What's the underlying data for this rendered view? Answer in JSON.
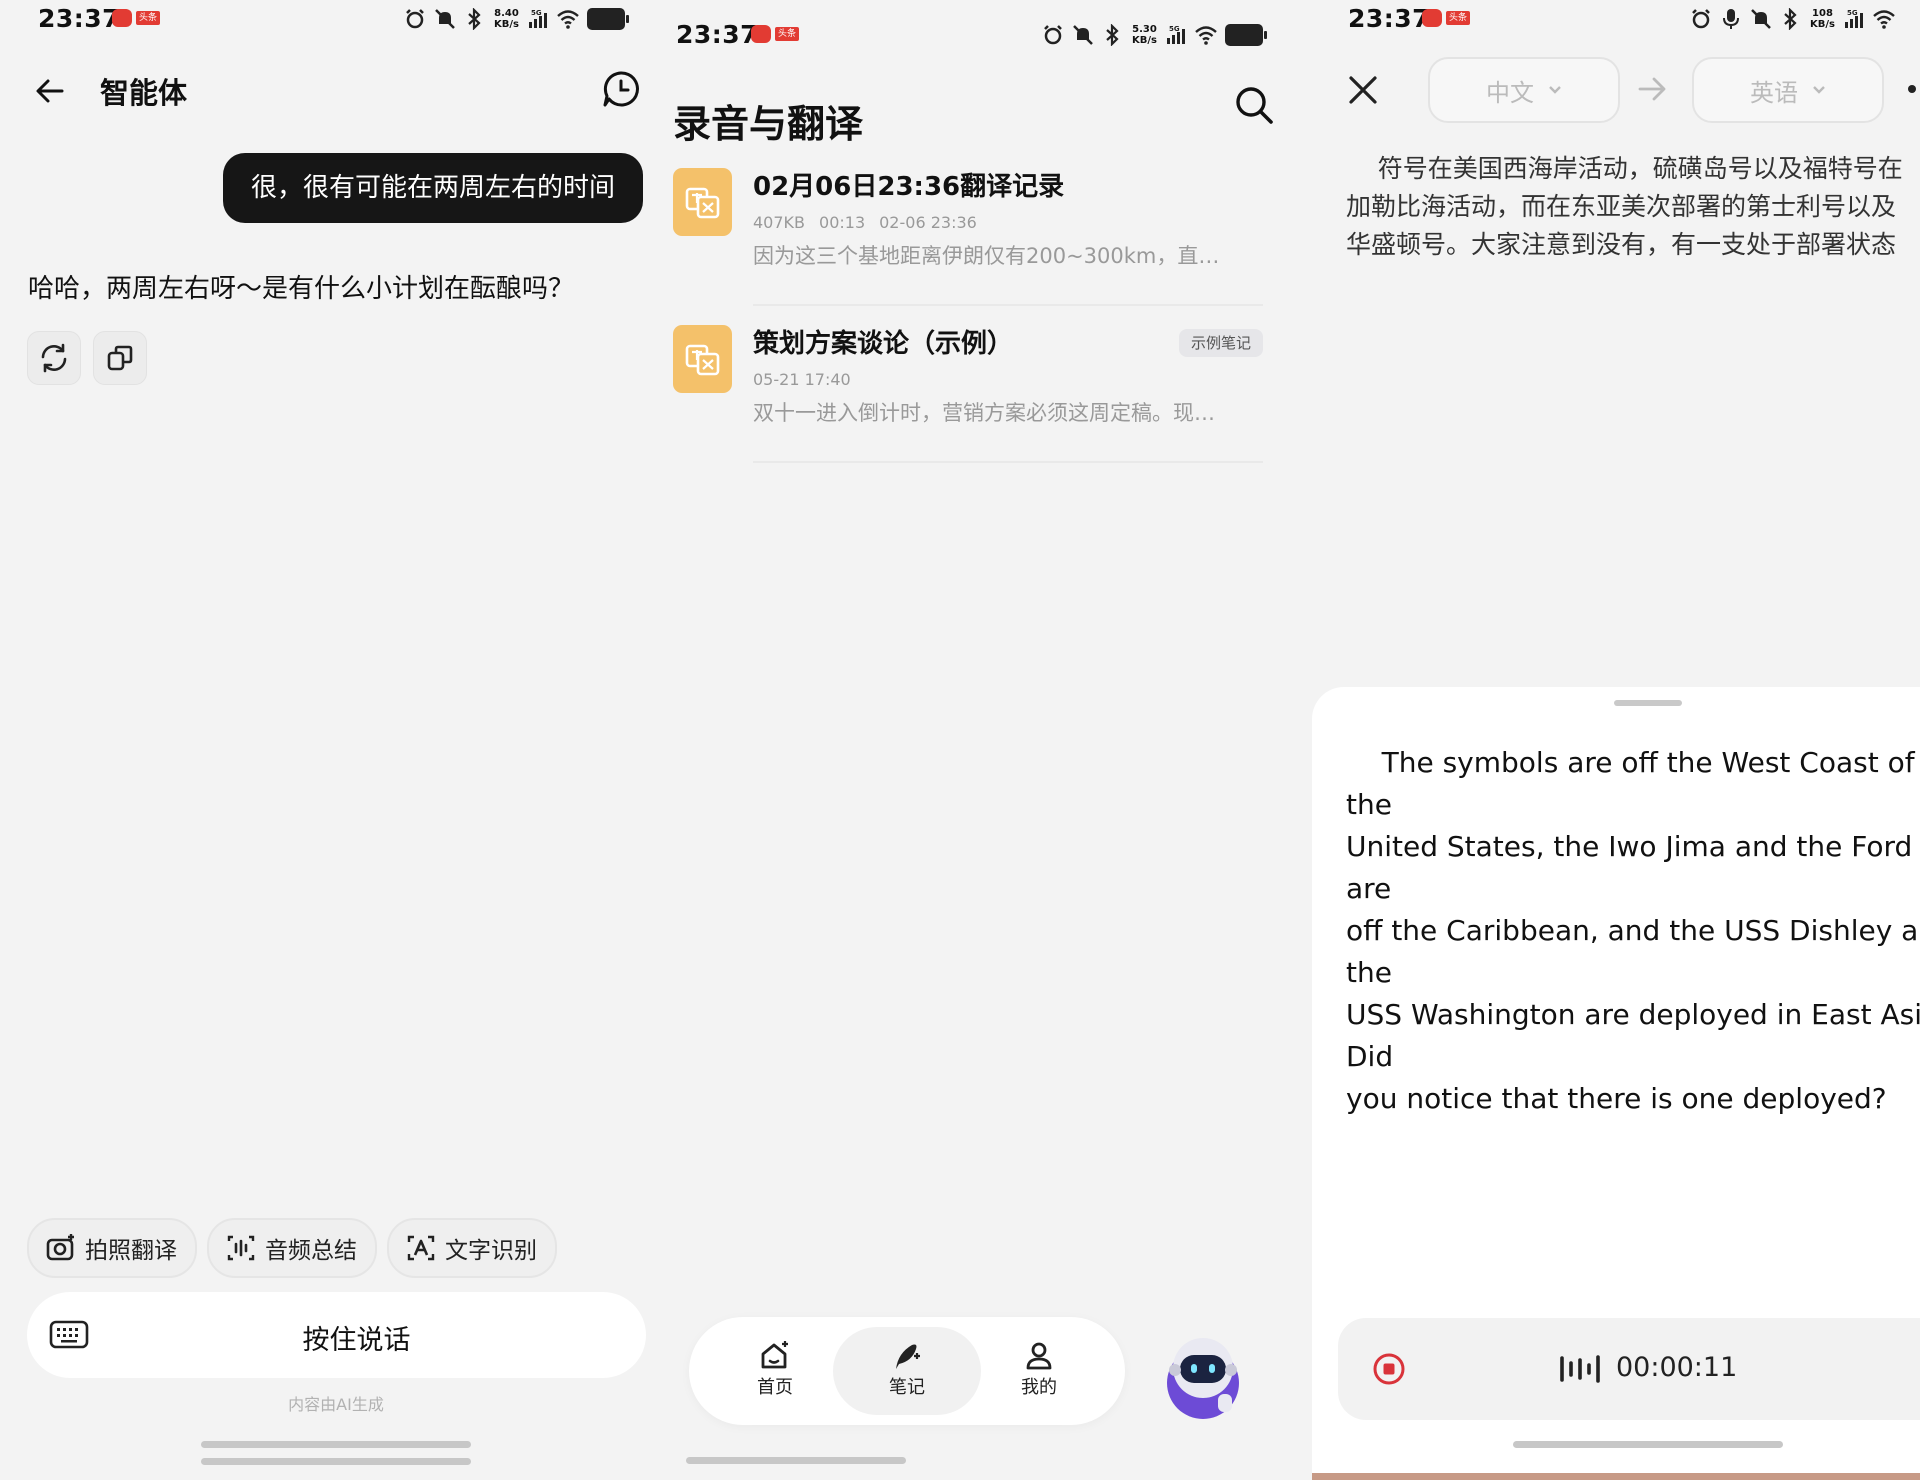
{
  "status_bars": [
    {
      "time": "23:37",
      "speed": "8.40\nKB/s",
      "net": "5G"
    },
    {
      "time": "23:37",
      "speed": "5.30\nKB/s",
      "net": "5G"
    },
    {
      "time": "23:37",
      "speed": "108\nKB/s",
      "net": "5G"
    }
  ],
  "status_tag": "头条",
  "agent_chat": {
    "title": "智能体",
    "user_message": "很，很有可能在两周左右的时间",
    "bot_message": "哈哈，两周左右呀～是有什么小计划在酝酿吗？",
    "quick_actions": [
      "拍照翻译",
      "音频总结",
      "文字识别"
    ],
    "voice_button_label": "按住说话",
    "ai_note": "内容由AI生成"
  },
  "recordings_page": {
    "title": "录音与翻译",
    "records": [
      {
        "title": "02月06日23:36翻译记录",
        "size": "407KB",
        "duration": "00:13",
        "date": "02-06 23:36",
        "snippet": "因为这三个基地距离伊朗仅有200~300km，直…",
        "tag": ""
      },
      {
        "title": "策划方案谈论（示例）",
        "size": "",
        "duration": "",
        "date": "05-21 17:40",
        "snippet": "双十一进入倒计时，营销方案必须这周定稿。现…",
        "tag": "示例笔记"
      }
    ],
    "nav": [
      "首页",
      "笔记",
      "我的"
    ],
    "active_nav": "笔记"
  },
  "translation_page": {
    "source_lang": "中文",
    "target_lang": "英语",
    "source_text": "    符号在美国西海岸活动，硫磺岛号以及福特号在\n加勒比海活动，而在东亚美次部署的第士利号以及\n华盛顿号。大家注意到没有，有一支处于部署状态",
    "translation_text": "    The symbols are off the West Coast of the\nUnited States, the Iwo Jima and the Ford are\noff the Caribbean, and the USS Dishley and the\nUSS Washington are deployed in East Asia. Did\nyou notice that there is one deployed?",
    "timer": "00:00:11"
  },
  "colors": {
    "thumb": "#f4c16a",
    "record_red": "#d9333a",
    "bubble": "#161616"
  }
}
